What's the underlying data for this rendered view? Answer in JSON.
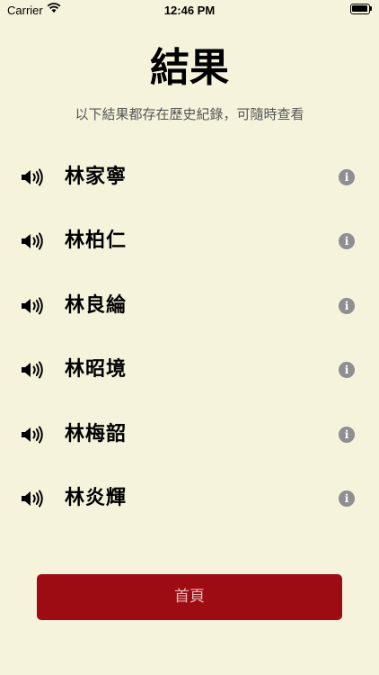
{
  "status_bar": {
    "carrier": "Carrier",
    "time": "12:46 PM"
  },
  "header": {
    "title": "結果",
    "subtitle": "以下結果都存在歷史紀錄，可隨時查看"
  },
  "results": [
    {
      "name": "林家寧"
    },
    {
      "name": "林柏仁"
    },
    {
      "name": "林良綸"
    },
    {
      "name": "林昭境"
    },
    {
      "name": "林梅韶"
    },
    {
      "name": "林炎輝"
    }
  ],
  "info_glyph": "i",
  "footer": {
    "home_label": "首頁"
  },
  "colors": {
    "background": "#f6f3dc",
    "accent": "#9c0c12",
    "info": "#8e8e93"
  }
}
